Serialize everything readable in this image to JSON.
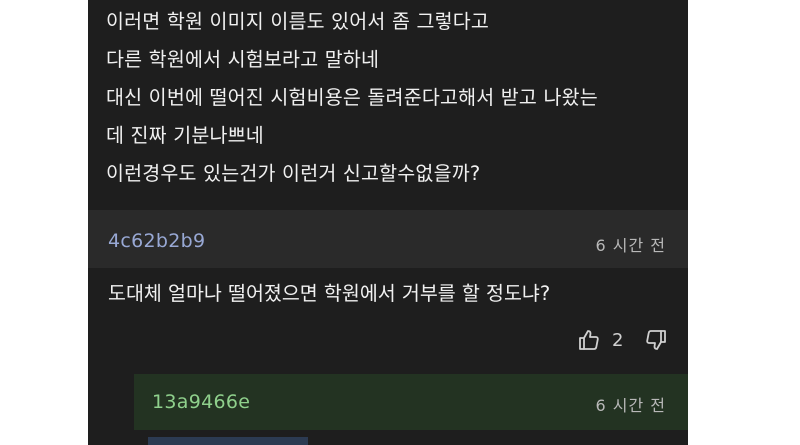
{
  "post": {
    "lines": [
      "이러면 학원 이미지 이름도 있어서 좀 그렇다고",
      "다른 학원에서 시험보라고 말하네",
      "대신 이번에 떨어진 시험비용은 돌려준다고해서 받고 나왔는",
      "데 진짜 기분나쁘네",
      "이런경우도 있는건가 이런거 신고할수없을까?"
    ]
  },
  "comment": {
    "author": "4c62b2b9",
    "time": "6 시간 전",
    "text": "도대체 얼마나 떨어졌으면 학원에서 거부를 할 정도냐?",
    "likes": "2",
    "like_icon": "thumbs-up-icon",
    "dislike_icon": "thumbs-down-icon"
  },
  "reply": {
    "author": "13a9466e",
    "time": "6 시간 전"
  },
  "colors": {
    "background": "#1e1e1e",
    "comment_header": "#2a2a2a",
    "comment_author": "#98a8d4",
    "reply_background": "#233322",
    "reply_author": "#8fd08c"
  }
}
